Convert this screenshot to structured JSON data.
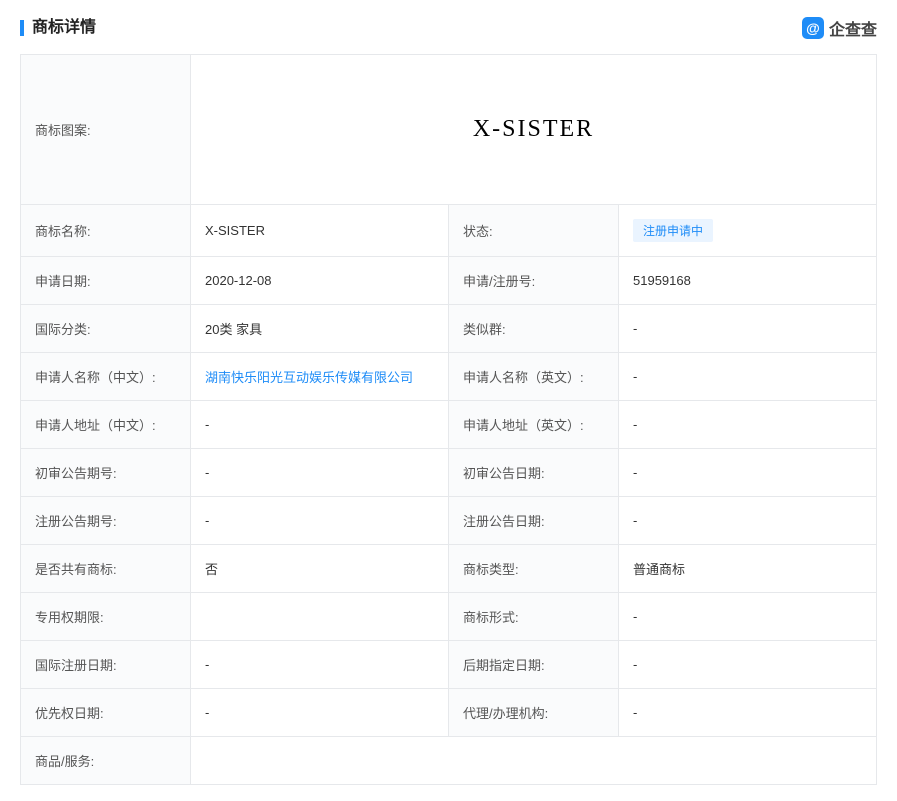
{
  "header": {
    "title": "商标详情",
    "brand_icon": "@",
    "brand_name": "企查查"
  },
  "trademark": {
    "image_label": "商标图案:",
    "image_text": "X-SISTER",
    "rows": [
      {
        "l1": "商标名称:",
        "v1": "X-SISTER",
        "l2": "状态:",
        "v2": "注册申请中",
        "v2_badge": true
      },
      {
        "l1": "申请日期:",
        "v1": "2020-12-08",
        "l2": "申请/注册号:",
        "v2": "51959168"
      },
      {
        "l1": "国际分类:",
        "v1": "20类 家具",
        "l2": "类似群:",
        "v2": "-"
      },
      {
        "l1": "申请人名称（中文）:",
        "v1": "湖南快乐阳光互动娱乐传媒有限公司",
        "v1_link": true,
        "l2": "申请人名称（英文）:",
        "v2": "-"
      },
      {
        "l1": "申请人地址（中文）:",
        "v1": "-",
        "l2": "申请人地址（英文）:",
        "v2": "-"
      },
      {
        "l1": "初审公告期号:",
        "v1": "-",
        "l2": "初审公告日期:",
        "v2": "-"
      },
      {
        "l1": "注册公告期号:",
        "v1": "-",
        "l2": "注册公告日期:",
        "v2": "-"
      },
      {
        "l1": "是否共有商标:",
        "v1": "否",
        "l2": "商标类型:",
        "v2": "普通商标"
      },
      {
        "l1": "专用权期限:",
        "v1": "",
        "l2": "商标形式:",
        "v2": "-"
      },
      {
        "l1": "国际注册日期:",
        "v1": "-",
        "l2": "后期指定日期:",
        "v2": "-"
      },
      {
        "l1": "优先权日期:",
        "v1": "-",
        "l2": "代理/办理机构:",
        "v2": "-"
      },
      {
        "l1": "商品/服务:",
        "v1": "",
        "colspan": 3
      }
    ]
  }
}
